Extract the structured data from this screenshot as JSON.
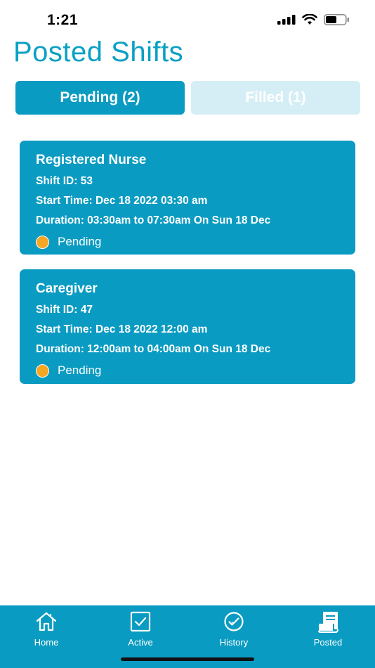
{
  "status_bar": {
    "time": "1:21"
  },
  "header": {
    "title": "Posted Shifts"
  },
  "tabs": [
    {
      "label": "Pending (2)",
      "active": true
    },
    {
      "label": "Filled (1)",
      "active": false
    }
  ],
  "shifts": [
    {
      "title": "Registered Nurse",
      "shift_id": "Shift ID: 53",
      "start_time": "Start Time: Dec 18 2022 03:30 am",
      "duration": "Duration: 03:30am to 07:30am On  Sun 18 Dec",
      "status": "Pending"
    },
    {
      "title": "Caregiver",
      "shift_id": "Shift ID: 47",
      "start_time": "Start Time: Dec 18 2022 12:00 am",
      "duration": "Duration: 12:00am to 04:00am On  Sun 18 Dec",
      "status": "Pending"
    }
  ],
  "bottom_nav": [
    {
      "label": "Home",
      "icon": "home-icon"
    },
    {
      "label": "Active",
      "icon": "checkbox-icon"
    },
    {
      "label": "History",
      "icon": "check-circle-icon"
    },
    {
      "label": "Posted",
      "icon": "receipt-icon"
    }
  ],
  "colors": {
    "primary": "#0a9bc2",
    "inactive_tab": "#d5eef5",
    "pending_dot": "#f5a623"
  }
}
